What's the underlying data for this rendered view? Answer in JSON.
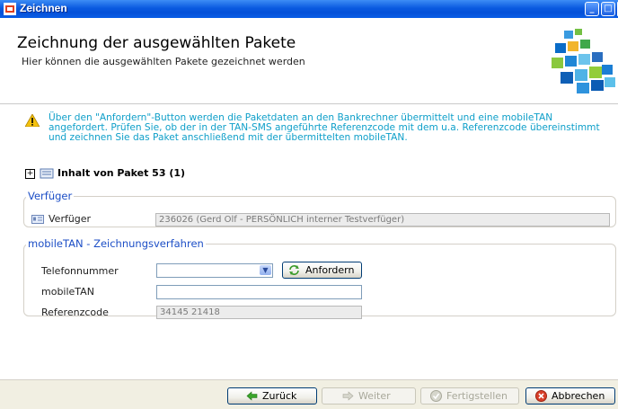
{
  "window": {
    "title": "Zeichnen",
    "minimize_label": "_",
    "maximize_label": "□",
    "close_label": "✕"
  },
  "header": {
    "title": "Zeichnung der ausgewählten Pakete",
    "subtitle": "Hier können die ausgewählten Pakete gezeichnet werden"
  },
  "notice": {
    "text": "Über den \"Anfordern\"-Button werden die Paketdaten an den Bankrechner übermittelt und eine mobileTAN angefordert. Prüfen Sie, ob der in der TAN-SMS angeführte Referenzcode mit dem u.a. Referenzcode übereinstimmt und zeichnen Sie das Paket anschließend mit der übermittelten mobileTAN."
  },
  "package": {
    "expand_symbol": "+",
    "label": "Inhalt von Paket 53 (1)"
  },
  "verfueger_section": {
    "legend": "Verfüger",
    "label": "Verfüger",
    "value": "236026 (Gerd Olf - PERSÖNLICH interner Testverfüger)"
  },
  "mobiletan_section": {
    "legend": "mobileTAN - Zeichnungsverfahren",
    "telefon_label": "Telefonnummer",
    "telefon_value": "",
    "anfordern_label": "Anfordern",
    "mobiletan_label": "mobileTAN",
    "mobiletan_value": "",
    "referenz_label": "Referenzcode",
    "referenz_value": "34145 21418"
  },
  "footer": {
    "back_label": "Zurück",
    "next_label": "Weiter",
    "finish_label": "Fertigstellen",
    "cancel_label": "Abbrechen"
  },
  "colors": {
    "titlebar": "#0a5ae0",
    "notice_text": "#0e9fc9",
    "legend": "#1c4ec6"
  }
}
